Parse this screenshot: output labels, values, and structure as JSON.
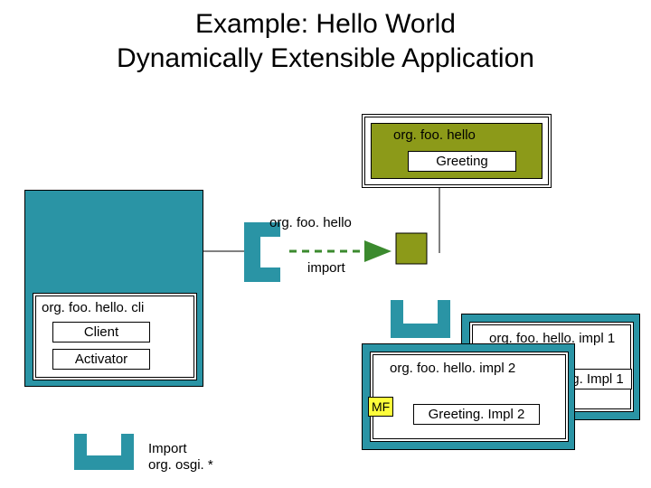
{
  "title": {
    "line1": "Example: Hello World",
    "line2": "Dynamically Extensible Application"
  },
  "topBundle": {
    "package": "org. foo. hello",
    "class": "Greeting"
  },
  "leftBundle": {
    "package": "org. foo. hello. cli",
    "class1": "Client",
    "class2": "Activator"
  },
  "importBracket": {
    "package": "org. foo. hello",
    "label": "import"
  },
  "rightBack": {
    "package": "org. foo. hello. impl 1",
    "class": "g. Impl 1"
  },
  "rightFront": {
    "package": "org. foo. hello. impl 2",
    "class": "Greeting. Impl 2",
    "mf": "MF"
  },
  "bottomImport": {
    "line1": "Import",
    "line2": "org. osgi. *"
  }
}
